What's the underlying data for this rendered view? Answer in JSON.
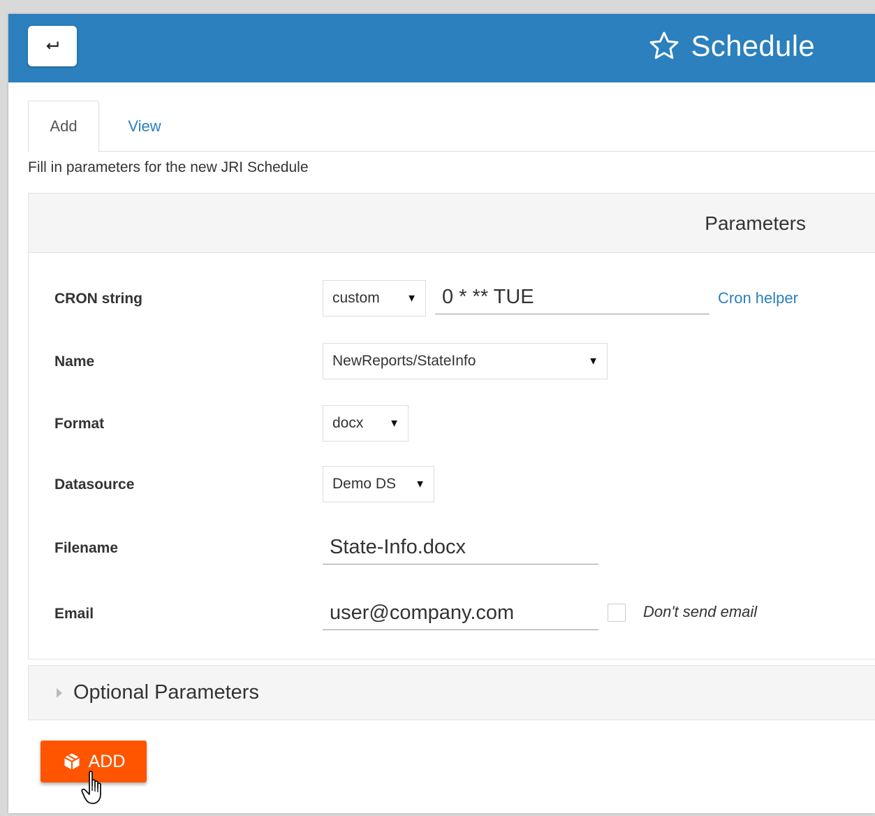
{
  "header": {
    "back_icon": "return-arrow-icon",
    "title_icon": "star-outline-icon",
    "title": "Schedule",
    "color": "#2b80bd"
  },
  "tabs": [
    {
      "label": "Add",
      "active": true
    },
    {
      "label": "View",
      "active": false
    }
  ],
  "intro_text": "Fill in parameters for the new JRI Schedule",
  "parameters": {
    "heading": "Parameters",
    "cron": {
      "label": "CRON string",
      "mode": "custom",
      "value": "0 * ** TUE",
      "helper_link": "Cron helper"
    },
    "name": {
      "label": "Name",
      "value": "NewReports/StateInfo"
    },
    "format": {
      "label": "Format",
      "value": "docx"
    },
    "datasource": {
      "label": "Datasource",
      "value": "Demo DS"
    },
    "filename": {
      "label": "Filename",
      "value": "State-Info.docx"
    },
    "email": {
      "label": "Email",
      "value": "user@company.com",
      "no_email_label": "Don't send email",
      "no_email_checked": false
    }
  },
  "optional": {
    "label": "Optional Parameters"
  },
  "add_button": {
    "label": "ADD",
    "icon": "cube-icon",
    "color": "#ff5500"
  },
  "caret_glyph": "▼"
}
